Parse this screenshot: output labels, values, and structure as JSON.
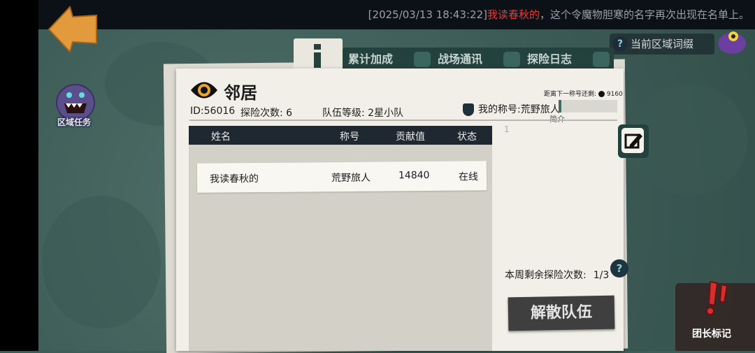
{
  "marquee": {
    "timestamp": "[2025/03/13 18:43:22]",
    "player_name": "我读春秋的",
    "message": "，这个令魔物胆寒的名字再次出现在名单上。"
  },
  "hud": {
    "region_affix": "当前区域词缀",
    "area_task": "区域任务",
    "leader_mark": "团长标记"
  },
  "tabs": [
    {
      "label": "累计加成"
    },
    {
      "label": "战场通讯"
    },
    {
      "label": "探险日志"
    }
  ],
  "team": {
    "title": "邻居",
    "id_text": "ID:56016",
    "explore_count_text": "探险次数: 6",
    "level_text": "队伍等级: 2星小队",
    "my_rank_text": "我的称号:荒野旅人",
    "next_rank_label": "距离下一称号还剩:",
    "next_rank_value": "9160",
    "intro_label": "简介",
    "intro_placeholder": "1",
    "rank_progress": 0.05
  },
  "table": {
    "headers": [
      "姓名",
      "称号",
      "贡献值",
      "状态"
    ],
    "rows": [
      [
        "我读春秋的",
        "荒野旅人",
        "14840",
        "在线"
      ]
    ]
  },
  "footer": {
    "weekly_remaining_label": "本周剩余探险次数:",
    "weekly_remaining_value": "1/3",
    "help": "?",
    "disband": "解散队伍"
  },
  "colors": {
    "accent": "#23413d",
    "marquee_name": "#e23b3b",
    "paper": "#f1efe8"
  }
}
